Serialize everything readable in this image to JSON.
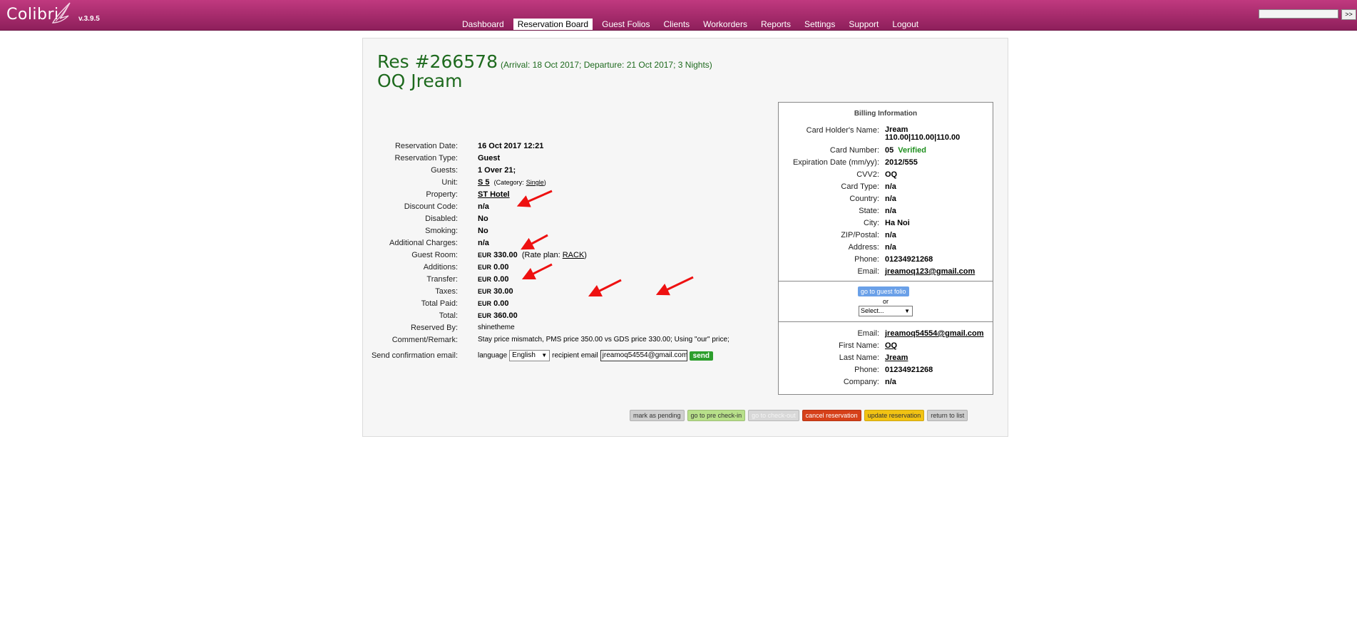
{
  "app": {
    "logo_text": "Colibri",
    "version": "v.3.9.5",
    "search_go_label": ">>"
  },
  "nav": {
    "items": [
      {
        "label": "Dashboard",
        "active": false
      },
      {
        "label": "Reservation Board",
        "active": true
      },
      {
        "label": "Guest Folios",
        "active": false
      },
      {
        "label": "Clients",
        "active": false
      },
      {
        "label": "Workorders",
        "active": false
      },
      {
        "label": "Reports",
        "active": false
      },
      {
        "label": "Settings",
        "active": false
      },
      {
        "label": "Support",
        "active": false
      },
      {
        "label": "Logout",
        "active": false
      }
    ]
  },
  "reservation": {
    "number": "Res #266578",
    "meta": "(Arrival: 18 Oct 2017; Departure: 21 Oct 2017; 3 Nights)",
    "guest_name": "OQ Jream",
    "fields": {
      "reservation_date": {
        "label": "Reservation Date:",
        "value": "16 Oct 2017 12:21"
      },
      "reservation_type": {
        "label": "Reservation Type:",
        "value": "Guest"
      },
      "guests": {
        "label": "Guests:",
        "value": "1 Over 21;"
      },
      "unit": {
        "label": "Unit:",
        "value": "S 5",
        "category_prefix": "(Category:",
        "category": "Single",
        "category_suffix": ")"
      },
      "property": {
        "label": "Property:",
        "value": "ST Hotel"
      },
      "discount_code": {
        "label": "Discount Code:",
        "value": "n/a"
      },
      "disabled": {
        "label": "Disabled:",
        "value": "No"
      },
      "smoking": {
        "label": "Smoking:",
        "value": "No"
      },
      "additional_charges": {
        "label": "Additional Charges:",
        "value": "n/a"
      },
      "guest_room": {
        "label": "Guest Room:",
        "currency": "EUR",
        "value": "330.00",
        "rate_prefix": "(Rate plan:",
        "rate_plan": "RACK",
        "rate_suffix": ")"
      },
      "additions": {
        "label": "Additions:",
        "currency": "EUR",
        "value": "0.00"
      },
      "transfer": {
        "label": "Transfer:",
        "currency": "EUR",
        "value": "0.00"
      },
      "taxes": {
        "label": "Taxes:",
        "currency": "EUR",
        "value": "30.00"
      },
      "total_paid": {
        "label": "Total Paid:",
        "currency": "EUR",
        "value": "0.00"
      },
      "total": {
        "label": "Total:",
        "currency": "EUR",
        "value": "360.00"
      },
      "reserved_by": {
        "label": "Reserved By:",
        "value": "shinetheme"
      },
      "comment": {
        "label": "Comment/Remark:",
        "value": "Stay price mismatch, PMS price 350.00 vs GDS price 330.00; Using \"our\" price;"
      }
    },
    "confirmation": {
      "label": "Send confirmation email:",
      "language_label": "language",
      "language_value": "English",
      "recipient_label": "recipient email",
      "recipient_value": "jreamoq54554@gmail.com",
      "send_label": "send"
    }
  },
  "billing": {
    "title": "Billing Information",
    "card_holder": {
      "label": "Card Holder's Name:",
      "value": "Jream",
      "value2": "110.00|110.00|110.00"
    },
    "card_number": {
      "label": "Card Number:",
      "value": "05",
      "status": "Verified"
    },
    "expiration": {
      "label": "Expiration Date (mm/yy):",
      "value": "2012/555"
    },
    "cvv2": {
      "label": "CVV2:",
      "value": "OQ"
    },
    "card_type": {
      "label": "Card Type:",
      "value": "n/a"
    },
    "country": {
      "label": "Country:",
      "value": "n/a"
    },
    "state": {
      "label": "State:",
      "value": "n/a"
    },
    "city": {
      "label": "City:",
      "value": "Ha Noi"
    },
    "zip": {
      "label": "ZIP/Postal:",
      "value": "n/a"
    },
    "address": {
      "label": "Address:",
      "value": "n/a"
    },
    "phone": {
      "label": "Phone:",
      "value": "01234921268"
    },
    "email": {
      "label": "Email:",
      "value": "jreamoq123@gmail.com"
    },
    "folio_button": "go to guest folio",
    "or_text": "or",
    "select_placeholder": "Select...",
    "client": {
      "email": {
        "label": "Email:",
        "value": "jreamoq54554@gmail.com"
      },
      "first_name": {
        "label": "First Name:",
        "value": "OQ"
      },
      "last_name": {
        "label": "Last Name:",
        "value": "Jream"
      },
      "phone": {
        "label": "Phone:",
        "value": "01234921268"
      },
      "company": {
        "label": "Company:",
        "value": "n/a"
      }
    }
  },
  "actions": {
    "mark_pending": "mark as pending",
    "pre_checkin": "go to pre check-in",
    "checkout": "go to check-out",
    "cancel": "cancel reservation",
    "update": "update reservation",
    "return": "return to list"
  },
  "colors": {
    "topbar": "#a82a6c",
    "accent_green": "#1e6a1e",
    "annotation_arrow": "#ee1111"
  }
}
